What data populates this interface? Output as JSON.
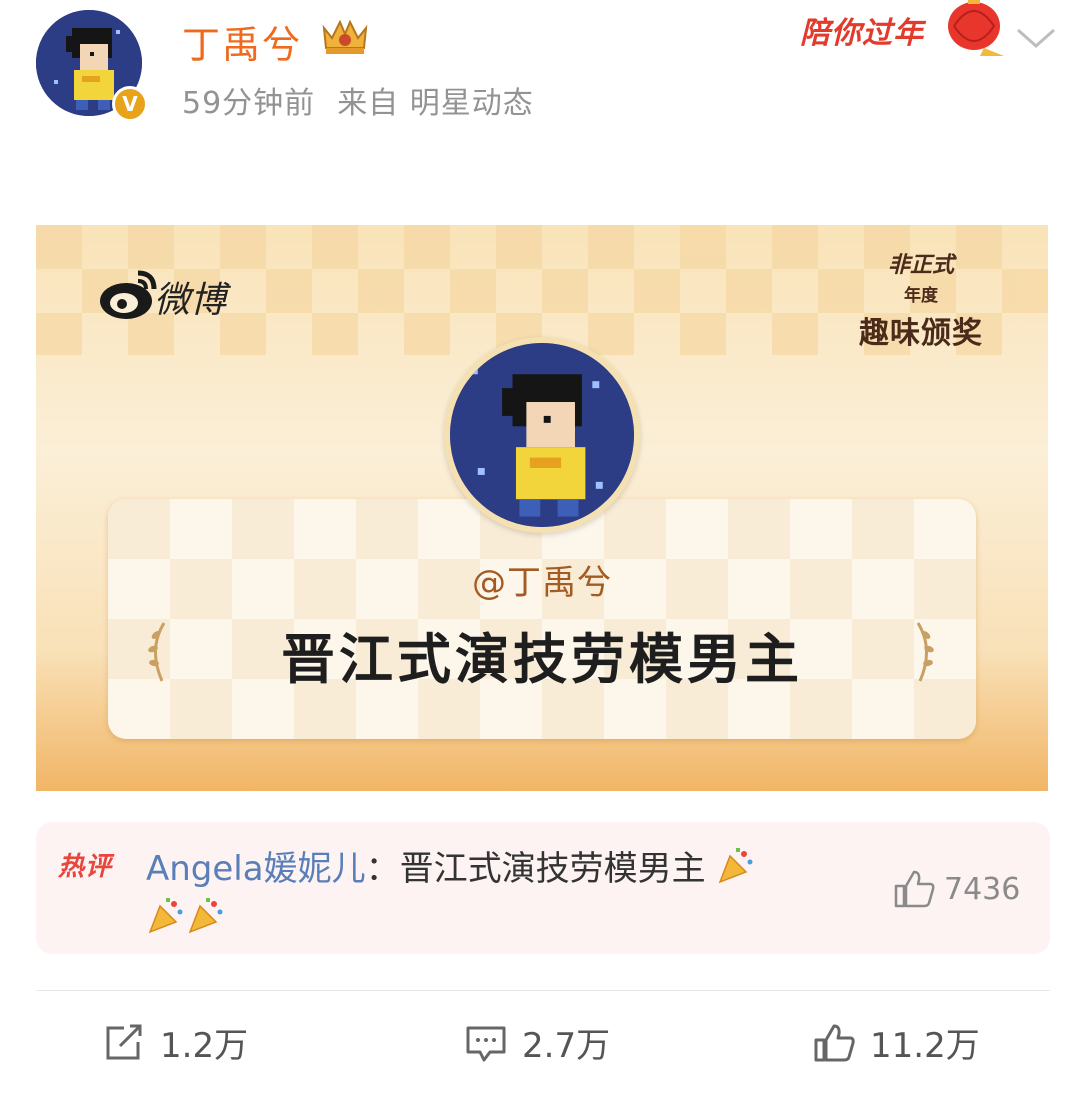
{
  "post": {
    "username": "丁禹兮",
    "time": "59分钟前",
    "source": "来自 明星动态",
    "verified_badge": "V",
    "festive_label": "陪你过年"
  },
  "award": {
    "logo_text": "微博",
    "tag_line1": "非正式",
    "tag_line2": "年度",
    "tag_line3": "趣味颁奖",
    "handle": "@丁禹兮",
    "title": "晋江式演技劳模男主"
  },
  "hot_comment": {
    "badge": "热评",
    "user": "Angela媛妮儿",
    "separator": "：",
    "text": "晋江式演技劳模男主",
    "emoji_icon": "party-popper-icon",
    "likes": "7436"
  },
  "actions": {
    "repost": "1.2万",
    "comment": "2.7万",
    "like": "11.2万"
  },
  "colors": {
    "username": "#f06a1e",
    "meta": "#939393",
    "hot_badge": "#e8453c",
    "comment_user": "#5a7fb8",
    "award_handle": "#a25b22",
    "card_bg": "#f9e3b8"
  }
}
